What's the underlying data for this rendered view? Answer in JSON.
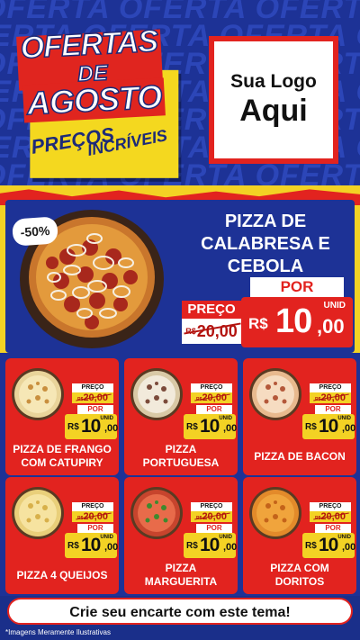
{
  "background_words": [
    "OFERTA OFERTA OFERTA OFERTA",
    "OFERTA OFERTA OFERTA OFERTA",
    "OFERTA OFERTA OFERTA OFERTA",
    "OFERTA OFERTA OFERTA OFERTA",
    "OFERTA OFERTA OFERTA OFERTA",
    "OFERTA OFERTA OFERTA OFERTA",
    "OFERTA OFERTA OFERTA OFERTA"
  ],
  "promo": {
    "line1": "OFERTAS",
    "line2": "DE",
    "line3": "AGOSTO",
    "subtitle1": "PREÇOS",
    "subtitle2": "INCRÍVEIS"
  },
  "logo": {
    "line1": "Sua Logo",
    "line2": "Aqui"
  },
  "feature": {
    "badge": "-50%",
    "title_lines": [
      "PIZZA DE",
      "CALABRESA E",
      "CEBOLA"
    ],
    "price_label": "PREÇO",
    "old_currency": "R$",
    "old_price": "20,00",
    "por_label": "POR",
    "unit_label": "UNID",
    "new_currency": "R$",
    "new_price_int": "10",
    "new_price_dec": ",00"
  },
  "products": [
    {
      "name_lines": [
        "PIZZA DE FRANGO",
        "COM CATUPIRY"
      ],
      "price_label": "PREÇO",
      "old_currency": "R$",
      "old_price": "20,00",
      "por_label": "POR",
      "unit_label": "UNID",
      "currency": "R$",
      "price_int": "10",
      "price_dec": ",00",
      "thumb": "chicken-pizza"
    },
    {
      "name_lines": [
        "PIZZA",
        "PORTUGUESA"
      ],
      "price_label": "PREÇO",
      "old_currency": "R$",
      "old_price": "20,00",
      "por_label": "POR",
      "unit_label": "UNID",
      "currency": "R$",
      "price_int": "10",
      "price_dec": ",00",
      "thumb": "portuguesa-pizza"
    },
    {
      "name_lines": [
        "PIZZA DE BACON",
        ""
      ],
      "price_label": "PREÇO",
      "old_currency": "R$",
      "old_price": "20,00",
      "por_label": "POR",
      "unit_label": "UNID",
      "currency": "R$",
      "price_int": "10",
      "price_dec": ",00",
      "thumb": "bacon-pizza"
    },
    {
      "name_lines": [
        "PIZZA 4 QUEIJOS",
        ""
      ],
      "price_label": "PREÇO",
      "old_currency": "R$",
      "old_price": "20,00",
      "por_label": "POR",
      "unit_label": "UNID",
      "currency": "R$",
      "price_int": "10",
      "price_dec": ",00",
      "thumb": "cheese-pizza"
    },
    {
      "name_lines": [
        "PIZZA",
        "MARGUERITA"
      ],
      "price_label": "PREÇO",
      "old_currency": "R$",
      "old_price": "20,00",
      "por_label": "POR",
      "unit_label": "UNID",
      "currency": "R$",
      "price_int": "10",
      "price_dec": ",00",
      "thumb": "margherita-pizza"
    },
    {
      "name_lines": [
        "PIZZA COM",
        "DORITOS"
      ],
      "price_label": "PREÇO",
      "old_currency": "R$",
      "old_price": "20,00",
      "por_label": "POR",
      "unit_label": "UNID",
      "currency": "R$",
      "price_int": "10",
      "price_dec": ",00",
      "thumb": "doritos-pizza"
    }
  ],
  "cta": "Crie seu encarte com este tema!",
  "footnote": "*Imagens Meramente Ilustrativas",
  "colors": {
    "blue": "#1d3296",
    "red": "#e2231f",
    "yellow": "#f3d224",
    "white": "#ffffff"
  }
}
